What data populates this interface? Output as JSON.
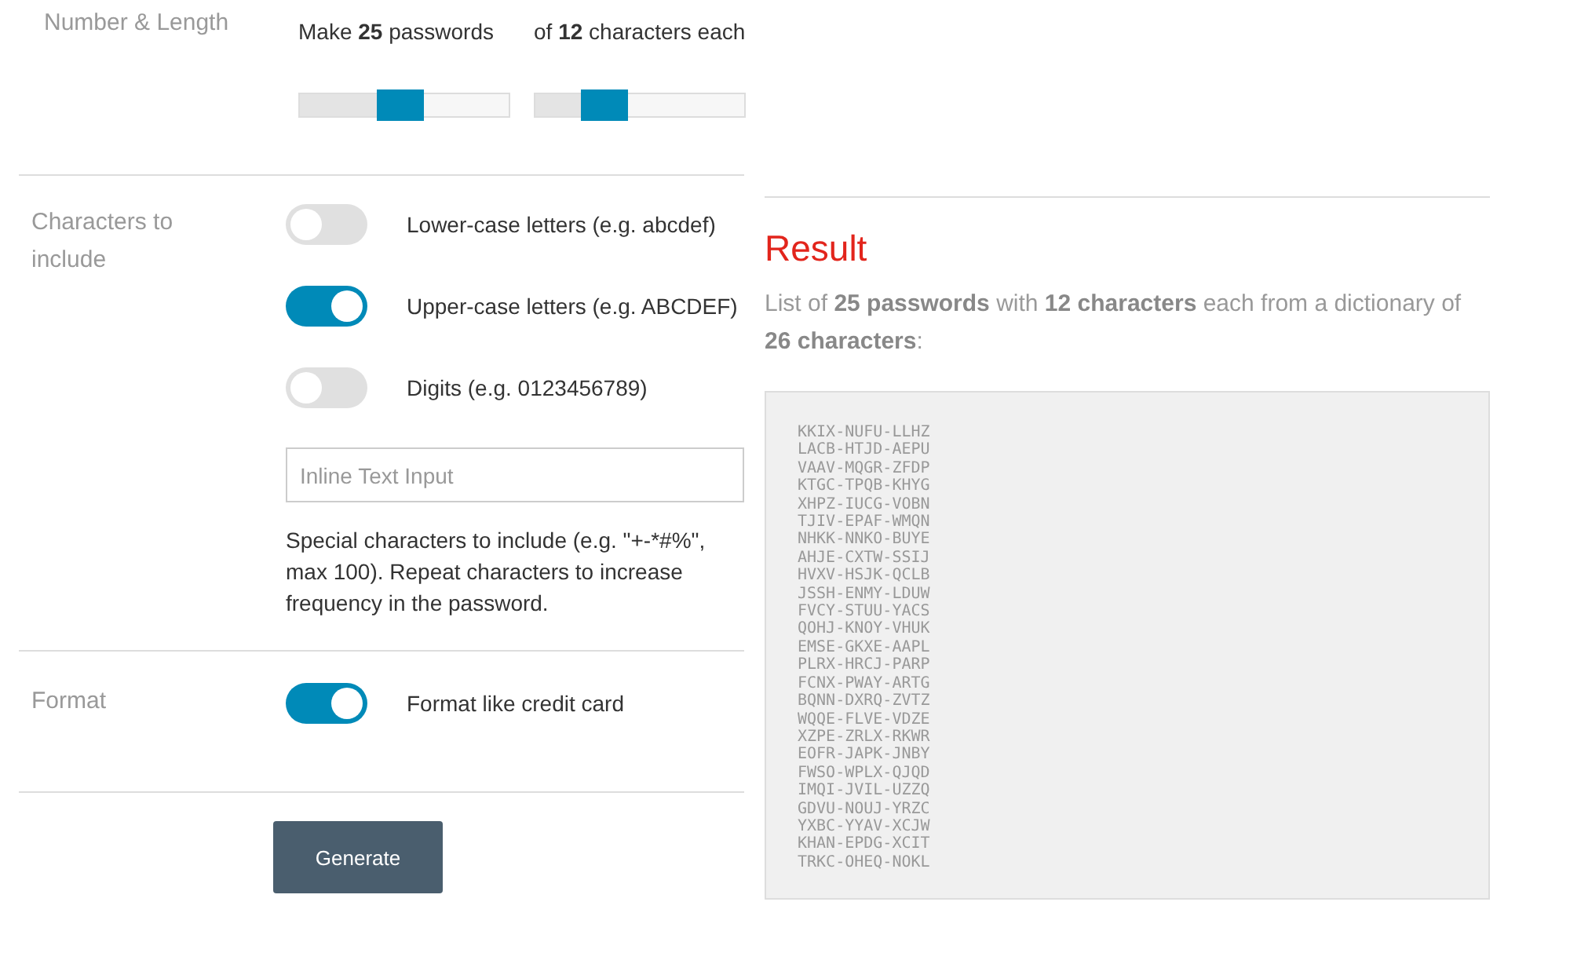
{
  "number_length": {
    "label": "Number & Length",
    "sliders": [
      {
        "caption": "Make **25** passwords",
        "level": 0.48
      },
      {
        "caption": "of **12** characters each",
        "level": 0.33
      }
    ]
  },
  "characters": {
    "label": "Characters to include",
    "toggles": [
      {
        "label": "Lower-case letters (e.g. abcdef)",
        "on": false
      },
      {
        "label": "Upper-case letters (e.g. ABCDEF)",
        "on": true
      },
      {
        "label": "Digits (e.g. 0123456789)",
        "on": false
      }
    ],
    "special": {
      "placeholder": "Inline Text Input",
      "help": "Special characters to include (e.g. \"+-*#%\", max 100). Repeat characters to increase frequency in the password."
    }
  },
  "format": {
    "label": "Format",
    "toggle": {
      "label": "Format like credit card",
      "on": true
    }
  },
  "generate_button": "Generate",
  "result": {
    "title": "Result",
    "summary": "List of **25 passwords** with **12 characters** each from a dictionary of **26 characters**:",
    "passwords": [
      "KKIX-NUFU-LLHZ",
      "LACB-HTJD-AEPU",
      "VAAV-MQGR-ZFDP",
      "KTGC-TPQB-KHYG",
      "XHPZ-IUCG-VOBN",
      "TJIV-EPAF-WMQN",
      "NHKK-NNKO-BUYE",
      "AHJE-CXTW-SSIJ",
      "HVXV-HSJK-QCLB",
      "JSSH-ENMY-LDUW",
      "FVCY-STUU-YACS",
      "QOHJ-KNOY-VHUK",
      "EMSE-GKXE-AAPL",
      "PLRX-HRCJ-PARP",
      "FCNX-PWAY-ARTG",
      "BQNN-DXRQ-ZVTZ",
      "WQQE-FLVE-VDZE",
      "XZPE-ZRLX-RKWR",
      "EOFR-JAPK-JNBY",
      "FWSO-WPLX-QJQD",
      "IMQI-JVIL-UZZQ",
      "GDVU-NOUJ-YRZC",
      "YXBC-YYAV-XCJW",
      "KHAN-EPDG-XCIT",
      "TRKC-OHEQ-NOKL"
    ]
  }
}
